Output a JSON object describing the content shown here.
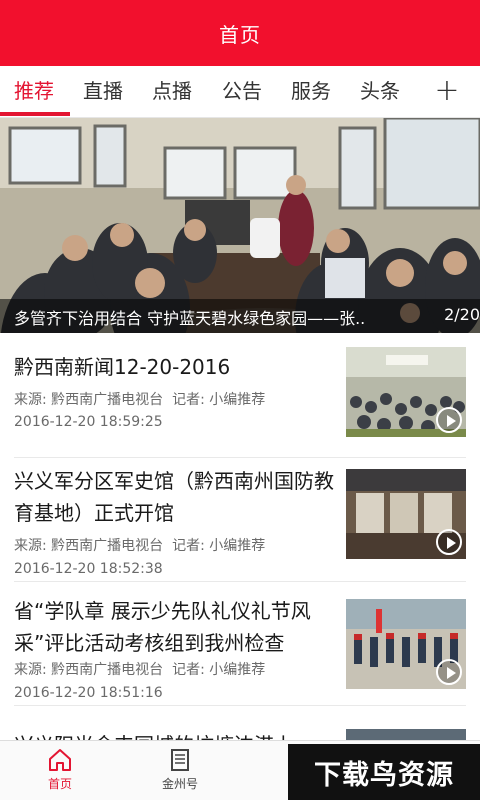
{
  "header": {
    "title": "首页"
  },
  "tabs": [
    {
      "label": "推荐",
      "active": true
    },
    {
      "label": "直播"
    },
    {
      "label": "点播"
    },
    {
      "label": "公告"
    },
    {
      "label": "服务"
    },
    {
      "label": "头条"
    }
  ],
  "tab_add_label": "+",
  "banner": {
    "title": "多管齐下治用结合 守护蓝天碧水绿色家园——张..",
    "counter": "2/20"
  },
  "news": [
    {
      "title": "黔西南新闻12-20-2016",
      "source": "来源: 黔西南广播电视台",
      "reporter": "记者: 小编推荐",
      "time": "2016-12-20 18:59:25"
    },
    {
      "title": "兴义军分区军史馆（黔西南州国防教育基地）正式开馆",
      "source": "来源: 黔西南广播电视台",
      "reporter": "记者: 小编推荐",
      "time": "2016-12-20 18:52:38"
    },
    {
      "title": "省“学队章 展示少先队礼仪礼节风采”评比活动考核组到我州检查",
      "source": "来源: 黔西南广播电视台",
      "reporter": "记者: 小编推荐",
      "time": "2016-12-20 18:51:16"
    },
    {
      "title": "兴义阳光金丰园城的坑塘边港上"
    }
  ],
  "bottom_nav": [
    {
      "label": "首页",
      "icon": "home-icon",
      "active": true
    },
    {
      "label": "金州号",
      "icon": "newspaper-icon"
    }
  ],
  "watermark": {
    "text": "下载鸟资源"
  },
  "colors": {
    "brand_red": "#f2102d",
    "active_red": "#e31532"
  }
}
